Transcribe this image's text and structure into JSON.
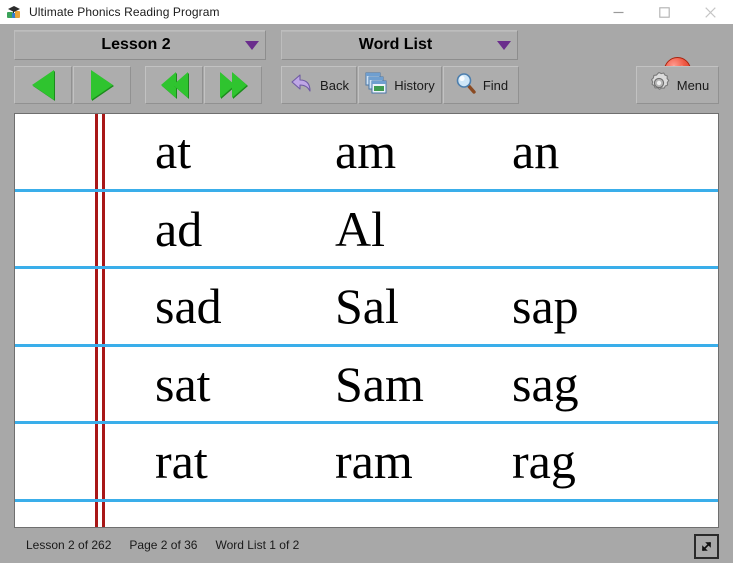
{
  "window": {
    "title": "Ultimate Phonics Reading Program",
    "app_icon": "graduation-cap-icon",
    "controls": {
      "minimize": "minimize-icon",
      "maximize": "maximize-icon",
      "close": "close-icon"
    }
  },
  "toolbar": {
    "lesson_selector": {
      "label": "Lesson 2",
      "caret": "chevron-down-icon"
    },
    "view_selector": {
      "label": "Word List",
      "caret": "chevron-down-icon"
    },
    "nav": {
      "prev": "previous-arrow-icon",
      "next": "next-arrow-icon",
      "first": "rewind-arrow-icon",
      "last": "fast-forward-arrow-icon"
    },
    "back_label": "Back",
    "back_icon": "back-arrow-icon",
    "history_label": "History",
    "history_icon": "stacked-windows-icon",
    "find_label": "Find",
    "find_icon": "magnifier-icon",
    "menu_label": "Menu",
    "menu_icon": "gear-icon",
    "close_round_icon": "close-circle-icon"
  },
  "content": {
    "rows": [
      [
        "at",
        "am",
        "an"
      ],
      [
        "ad",
        "Al",
        ""
      ],
      [
        "sad",
        "Sal",
        "sap"
      ],
      [
        "sat",
        "Sam",
        "sag"
      ],
      [
        "rat",
        "ram",
        "rag"
      ]
    ]
  },
  "statusbar": {
    "lesson_progress": "Lesson 2 of 262",
    "page_progress": "Page 2 of 36",
    "wordlist_progress": "Word List 1 of 2",
    "resize_icon": "resize-diagonal-icon"
  },
  "colors": {
    "rule_line": "#3aaeea",
    "margin_line": "#a81717",
    "nav_green": "#2fc42f",
    "caret_purple": "#6a2d8c",
    "chrome_gray": "#a8a8a8"
  }
}
